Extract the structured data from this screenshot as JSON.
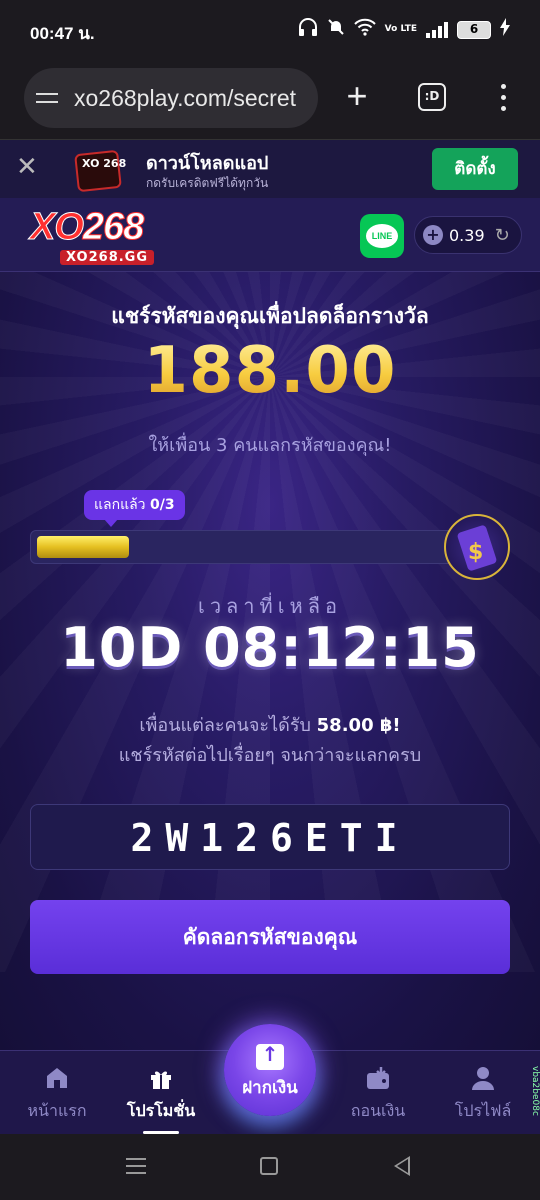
{
  "status_bar": {
    "time": "00:47 น.",
    "volte": "Vo LTE",
    "battery": "6"
  },
  "browser": {
    "url": "xo268play.com/secret",
    "plus_icon": "plus-icon",
    "tabs_label": ":D",
    "menu_icon": "more-vert-icon"
  },
  "app_banner": {
    "title": "ดาวน์โหลดแอป",
    "subtitle": "กดรับเครดิตฟรีได้ทุกวัน",
    "install_label": "ติดตั้ง",
    "logo_text": "XO 268"
  },
  "header": {
    "logo_main_xo": "XO",
    "logo_main_num": "268",
    "logo_sub": "XO268.GG",
    "line_label": "LINE",
    "balance": "0.39"
  },
  "reward": {
    "title": "แชร์รหัสของคุณเพื่อปลดล็อกรางวัล",
    "amount": "188.00",
    "invite_text": "ให้เพื่อน 3 คนแลกรหัสของคุณ!",
    "progress_label": "แลกแล้ว",
    "progress_count": "0/3",
    "progress_fraction": 0.22,
    "time_label": "เวลาที่เหลือ",
    "countdown": "10D 08:12:15",
    "per_friend_text": "เพื่อนแต่ละคนจะได้รับ",
    "per_friend_amount": "58.00 ฿!",
    "share_text": "แชร์รหัสต่อไปเรื่อยๆ จนกว่าจะแลกครบ",
    "code": "2W126ETI",
    "copy_label": "คัดลอกรหัสของคุณ"
  },
  "nav": {
    "items": [
      {
        "label": "หน้าแรก",
        "icon": "home-icon"
      },
      {
        "label": "โปรโมชั่น",
        "icon": "gift-icon"
      },
      {
        "label": "ฝากเงิน",
        "icon": "deposit-icon"
      },
      {
        "label": "ถอนเงิน",
        "icon": "wallet-icon"
      },
      {
        "label": "โปรไฟล์",
        "icon": "user-icon"
      }
    ],
    "version_tag": "vba2be08c"
  },
  "colors": {
    "accent": "#6a34e6",
    "gold": "#f5c84a",
    "install_green": "#14a35a",
    "line_green": "#06c755"
  }
}
